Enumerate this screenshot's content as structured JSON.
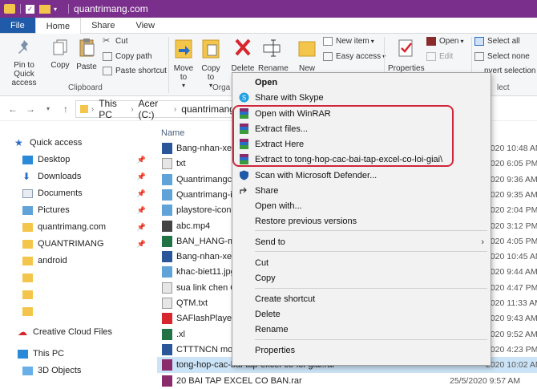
{
  "window": {
    "title": "quantrimang.com"
  },
  "tabs": [
    "File",
    "Home",
    "Share",
    "View"
  ],
  "ribbon": {
    "pin_label": "Pin to Quick access",
    "copy": "Copy",
    "paste": "Paste",
    "cut": "Cut",
    "copy_path": "Copy path",
    "paste_shortcut": "Paste shortcut",
    "clipboard_group": "Clipboard",
    "move_to": "Move to",
    "copy_to": "Copy to",
    "delete": "Delete",
    "rename": "Rename",
    "organize_group": "Orga",
    "new_folder": "New",
    "new_item": "New item",
    "easy_access": "Easy access",
    "properties": "Properties",
    "open": "Open",
    "edit": "Edit",
    "select_all": "Select all",
    "select_none": "Select none",
    "invert_selection": "nvert selection",
    "select_group": "lect"
  },
  "address": {
    "crumbs": [
      "This PC",
      "Acer (C:)",
      "quantrimang"
    ]
  },
  "nav_pane": {
    "quick_access": "Quick access",
    "items": [
      "Desktop",
      "Downloads",
      "Documents",
      "Pictures",
      "quantrimang.com",
      "QUANTRIMANG",
      "android"
    ],
    "creative_cloud": "Creative Cloud Files",
    "this_pc": "This PC",
    "objects_3d": "3D Objects"
  },
  "file_list": {
    "col_name": "Name",
    "rows": [
      {
        "name": "Bang-nhan-xet-",
        "date": "2020 10:48 AM",
        "icon": "word"
      },
      {
        "name": "txt",
        "date": "2020 6:05 PM",
        "icon": "text"
      },
      {
        "name": "Quantrimangcc",
        "date": "2020 9:36 AM",
        "icon": "image"
      },
      {
        "name": "Quantrimang-ic",
        "date": "2020 9:35 AM",
        "icon": "image"
      },
      {
        "name": "playstore-icon.",
        "date": "2020 2:04 PM",
        "icon": "image"
      },
      {
        "name": "abc.mp4",
        "date": "2020 3:12 PM",
        "icon": "video"
      },
      {
        "name": "BAN_HANG-ma",
        "date": "2020 4:05 PM",
        "icon": "excel"
      },
      {
        "name": "Bang-nhan-xet-",
        "date": "2020 10:45 AM",
        "icon": "word"
      },
      {
        "name": "khac-biet11.jpg",
        "date": "2020 9:44 AM",
        "icon": "image"
      },
      {
        "name": "sua link chen Q",
        "date": "2020 4:47 PM",
        "icon": "text"
      },
      {
        "name": "QTM.txt",
        "date": "2020 11:33 AM",
        "icon": "text"
      },
      {
        "name": "SAFlashPlayer.e",
        "date": "2020 9:43 AM",
        "icon": "app"
      },
      {
        "name": ".xl",
        "date": "2020 9:52 AM",
        "icon": "excel"
      },
      {
        "name": "CTTTNCN moi-",
        "date": "2020 4:23 PM",
        "icon": "word"
      },
      {
        "name": "tong-hop-cac-bai-tap-excel-co-loi-giai.rar",
        "date": "2020 10:02 AM",
        "icon": "rar"
      },
      {
        "name": "20 BAI TAP EXCEL CO BAN.rar",
        "date": "25/5/2020 9:57 AM",
        "icon": "rar"
      }
    ]
  },
  "context_menu": {
    "open": "Open",
    "share_skype": "Share with Skype",
    "open_winrar": "Open with WinRAR",
    "extract_files": "Extract files...",
    "extract_here": "Extract Here",
    "extract_to": "Extract to tong-hop-cac-bai-tap-excel-co-loi-giai\\",
    "scan_defender": "Scan with Microsoft Defender...",
    "share": "Share",
    "open_with": "Open with...",
    "restore": "Restore previous versions",
    "send_to": "Send to",
    "cut": "Cut",
    "copy": "Copy",
    "create_shortcut": "Create shortcut",
    "delete": "Delete",
    "rename": "Rename",
    "properties": "Properties"
  },
  "colors": {
    "titlebar": "#7a2f8c",
    "file_tab": "#1f5ba8",
    "highlight": "#d0263b",
    "selection": "#cce4f7"
  }
}
